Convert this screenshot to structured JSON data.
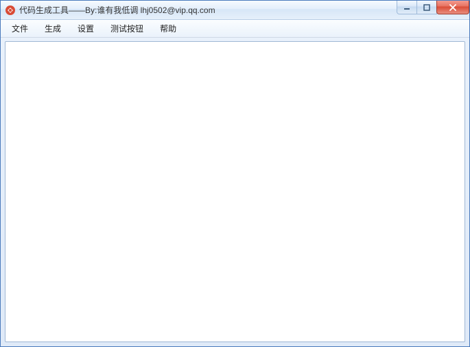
{
  "window": {
    "title": "代码生成工具——By:谁有我低调 lhj0502@vip.qq.com",
    "icon_name": "app-icon"
  },
  "window_controls": {
    "minimize": "minimize",
    "maximize": "maximize",
    "close": "close"
  },
  "menubar": {
    "items": [
      {
        "label": "文件"
      },
      {
        "label": "生成"
      },
      {
        "label": "设置"
      },
      {
        "label": "测试按钮"
      },
      {
        "label": "帮助"
      }
    ]
  }
}
